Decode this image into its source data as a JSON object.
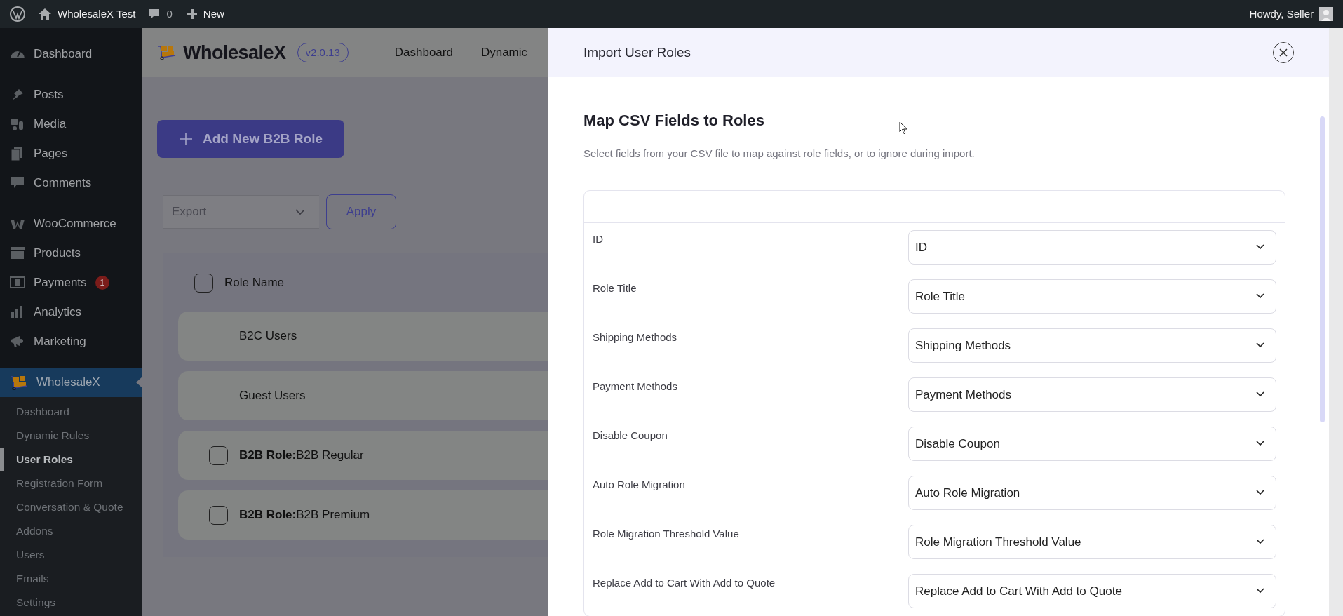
{
  "admin_bar": {
    "site_name": "WholesaleX Test",
    "comments_count": "0",
    "new_label": "New",
    "greeting": "Howdy, Seller"
  },
  "sidebar": {
    "groups": [
      [
        {
          "label": "Dashboard",
          "selected": false
        }
      ],
      [
        {
          "label": "Posts",
          "selected": false
        },
        {
          "label": "Media",
          "selected": false
        },
        {
          "label": "Pages",
          "selected": false
        },
        {
          "label": "Comments",
          "selected": false
        }
      ],
      [
        {
          "label": "WooCommerce",
          "selected": false
        },
        {
          "label": "Products",
          "selected": false
        },
        {
          "label": "Payments",
          "selected": false,
          "badge": "1"
        },
        {
          "label": "Analytics",
          "selected": false
        },
        {
          "label": "Marketing",
          "selected": false
        }
      ],
      [
        {
          "label": "WholesaleX",
          "selected": true
        }
      ]
    ],
    "submenu": [
      {
        "label": "Dashboard",
        "selected": false
      },
      {
        "label": "Dynamic Rules",
        "selected": false
      },
      {
        "label": "User Roles",
        "selected": true
      },
      {
        "label": "Registration Form",
        "selected": false
      },
      {
        "label": "Conversation & Quote",
        "selected": false
      },
      {
        "label": "Addons",
        "selected": false
      },
      {
        "label": "Users",
        "selected": false
      },
      {
        "label": "Emails",
        "selected": false
      },
      {
        "label": "Settings",
        "selected": false
      }
    ]
  },
  "plugin_header": {
    "brand": "WholesaleX",
    "version": "v2.0.13",
    "nav": [
      "Dashboard",
      "Dynamic"
    ]
  },
  "add_button": "Add New B2B Role",
  "bulk_action": {
    "value": "Export",
    "apply": "Apply"
  },
  "roles_table": {
    "header": {
      "label": "Role Name",
      "checked": false
    },
    "rows": [
      {
        "kind": "builtin",
        "label": "B2C Users"
      },
      {
        "kind": "builtin",
        "label": "Guest Users"
      },
      {
        "kind": "b2b",
        "label": "**B2B Role:**B2B Regular",
        "checked": false
      },
      {
        "kind": "b2b",
        "label": "**B2B Role:**B2B Premium",
        "checked": false
      }
    ]
  },
  "modal": {
    "title": "Import User Roles",
    "heading": "Map CSV Fields to Roles",
    "description": "Select fields from your CSV file to map against role fields, or to ignore during import.",
    "mapping": [
      {
        "field": "ID",
        "value": "ID"
      },
      {
        "field": "Role Title",
        "value": "Role Title"
      },
      {
        "field": "Shipping Methods",
        "value": "Shipping Methods"
      },
      {
        "field": "Payment Methods",
        "value": "Payment Methods"
      },
      {
        "field": "Disable Coupon",
        "value": "Disable Coupon"
      },
      {
        "field": "Auto Role Migration",
        "value": "Auto Role Migration"
      },
      {
        "field": "Role Migration Threshold Value",
        "value": "Role Migration Threshold Value"
      },
      {
        "field": "Replace Add to Cart With Add to Quote",
        "value": "Replace Add to Cart With Add to Quote"
      }
    ]
  }
}
